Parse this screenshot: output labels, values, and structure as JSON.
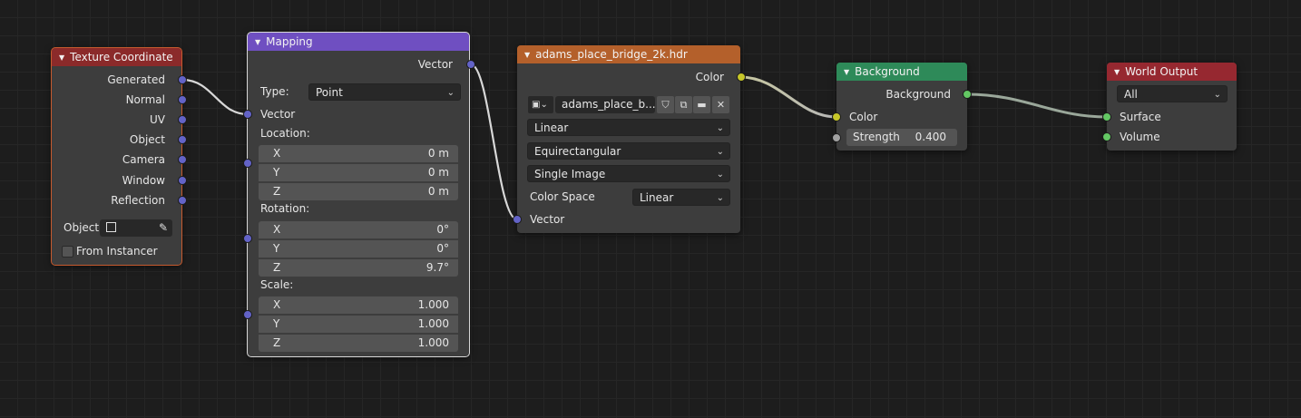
{
  "texture_coordinate": {
    "title": "Texture Coordinate",
    "outputs": [
      "Generated",
      "Normal",
      "UV",
      "Object",
      "Camera",
      "Window",
      "Reflection"
    ],
    "object_label": "Object",
    "from_instancer_label": "From Instancer"
  },
  "mapping": {
    "title": "Mapping",
    "output_label": "Vector",
    "type_label": "Type:",
    "type_value": "Point",
    "vector_label": "Vector",
    "location_label": "Location:",
    "location": [
      {
        "axis": "X",
        "value": "0 m"
      },
      {
        "axis": "Y",
        "value": "0 m"
      },
      {
        "axis": "Z",
        "value": "0 m"
      }
    ],
    "rotation_label": "Rotation:",
    "rotation": [
      {
        "axis": "X",
        "value": "0°"
      },
      {
        "axis": "Y",
        "value": "0°"
      },
      {
        "axis": "Z",
        "value": "9.7°"
      }
    ],
    "scale_label": "Scale:",
    "scale": [
      {
        "axis": "X",
        "value": "1.000"
      },
      {
        "axis": "Y",
        "value": "1.000"
      },
      {
        "axis": "Z",
        "value": "1.000"
      }
    ]
  },
  "environment": {
    "title": "adams_place_bridge_2k.hdr",
    "output_label": "Color",
    "image_name": "adams_place_b...",
    "interpolation": "Linear",
    "projection": "Equirectangular",
    "source": "Single Image",
    "color_space_label": "Color Space",
    "color_space_value": "Linear",
    "vector_label": "Vector"
  },
  "background": {
    "title": "Background",
    "output_label": "Background",
    "color_label": "Color",
    "strength_label": "Strength",
    "strength_value": "0.400"
  },
  "world_output": {
    "title": "World Output",
    "target": "All",
    "surface_label": "Surface",
    "volume_label": "Volume"
  },
  "colors": {
    "header_input": "#8b2a2a",
    "header_vector": "#6f4fc1",
    "header_texture": "#b4602b",
    "header_shader": "#2e8a59",
    "header_output": "#962830"
  },
  "icons": [
    "collapse-triangle-icon",
    "chevron-down-icon",
    "image-type-icon",
    "fake-user-shield-icon",
    "duplicate-icon",
    "folder-icon",
    "close-icon",
    "object-icon",
    "eyedropper-icon"
  ]
}
